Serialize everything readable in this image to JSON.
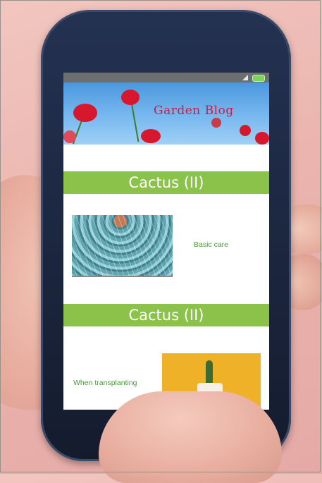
{
  "blog": {
    "title": "Garden Blog"
  },
  "sections": [
    {
      "header": "Cactus (II)",
      "caption": "Basic care"
    },
    {
      "header": "Cactus (II)",
      "caption": "When transplanting"
    }
  ],
  "colors": {
    "header_green": "#8bc34a",
    "caption_green": "#4c9a3a",
    "title_red": "#d01a45",
    "sky_blue": "#4b97de",
    "battery_green": "#7ed35a"
  },
  "icons": [
    "signal-icon",
    "battery-icon"
  ]
}
